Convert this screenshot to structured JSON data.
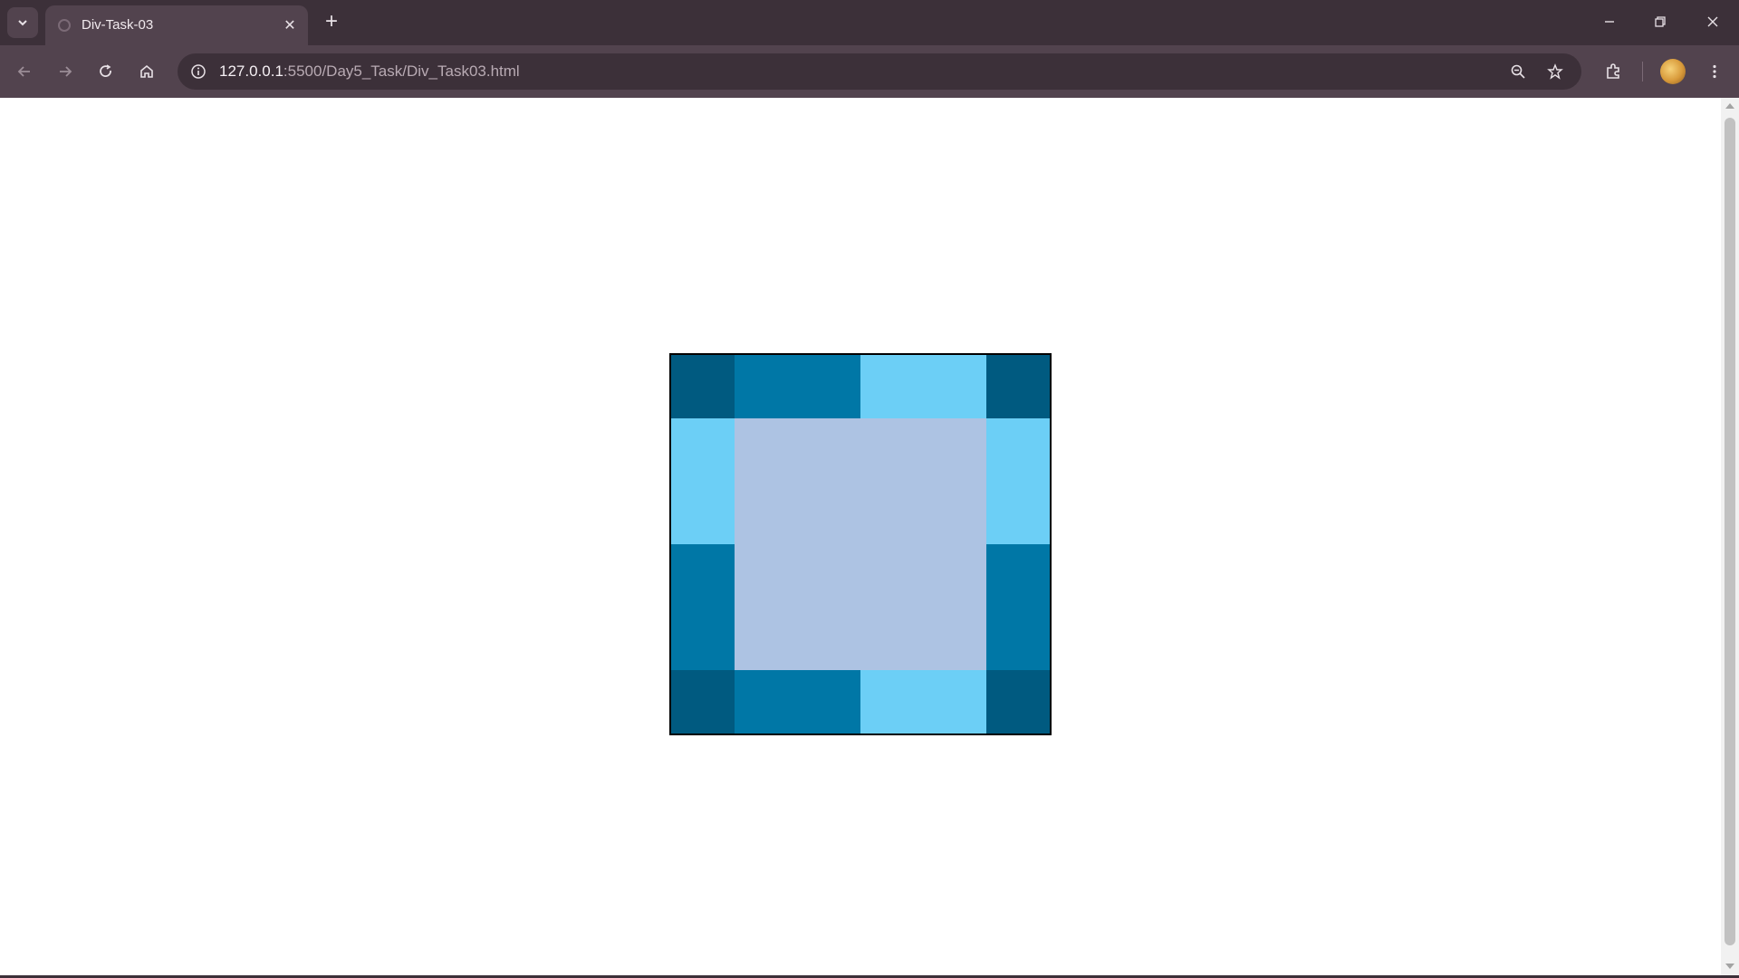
{
  "browser": {
    "tab_title": "Div-Task-03",
    "url_host": "127.0.0.1",
    "url_rest": ":5500/Day5_Task/Div_Task03.html",
    "icons": [
      "tab-list-icon",
      "close-icon",
      "plus-icon",
      "minimize-icon",
      "restore-icon",
      "back-arrow-icon",
      "forward-arrow-icon",
      "reload-icon",
      "home-icon",
      "info-icon",
      "zoom-out-icon",
      "star-icon",
      "extensions-icon",
      "avatar",
      "more-vert-icon"
    ]
  },
  "page": {
    "colors": {
      "dark": "#005a80",
      "mid": "#0077a6",
      "light": "#6ccff6",
      "center": "#adc3e3",
      "border": "#000000"
    },
    "grid": {
      "top_row": [
        "dark",
        "mid",
        "mid",
        "light",
        "light",
        "dark"
      ],
      "cells": [
        {
          "name": "cell-top-left",
          "color": "dark"
        },
        {
          "name": "cell-top-middle-left",
          "color": "mid"
        },
        {
          "name": "cell-top-middle-right",
          "color": "light"
        },
        {
          "name": "cell-top-right",
          "color": "dark"
        },
        {
          "name": "cell-left-upper",
          "color": "light"
        },
        {
          "name": "cell-right-upper",
          "color": "light"
        },
        {
          "name": "cell-left-lower",
          "color": "mid"
        },
        {
          "name": "cell-right-lower",
          "color": "mid"
        },
        {
          "name": "cell-bottom-left",
          "color": "dark"
        },
        {
          "name": "cell-bottom-middle-left",
          "color": "mid"
        },
        {
          "name": "cell-bottom-middle-right",
          "color": "light"
        },
        {
          "name": "cell-bottom-right",
          "color": "dark"
        },
        {
          "name": "cell-center",
          "color": "center"
        }
      ]
    }
  }
}
